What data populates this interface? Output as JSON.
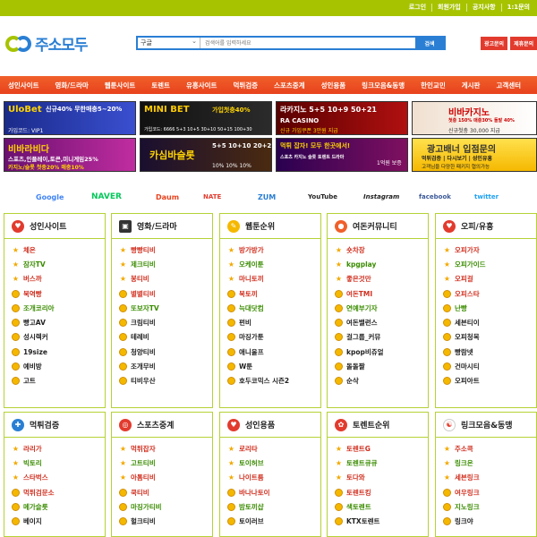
{
  "topbar": {
    "links": [
      "로그인",
      "회원가입",
      "공지사항",
      "1:1문의"
    ]
  },
  "logo": {
    "text": "주소모두"
  },
  "search": {
    "select": "구글",
    "placeholder": "검색어를 입력하세요",
    "button": "검색"
  },
  "ad_buttons": [
    "광고문의",
    "제휴문의"
  ],
  "nav": [
    "성인사이트",
    "영화/드라마",
    "웹툰사이트",
    "토렌트",
    "유흥사이트",
    "먹튀검증",
    "스포츠중계",
    "성인용품",
    "링크모음&동맹",
    "한인교민",
    "게시판",
    "고객센터"
  ],
  "banners": [
    {
      "t1": "UloBet",
      "t2": "신규40% 무한매충5~20%",
      "t3": "가입코드: VIP1"
    },
    {
      "t1": "MINI BET",
      "t2": "가입첫충40%",
      "t3": "가입코드: 6666 5+3 10+5 30+10 50+15 100+30"
    },
    {
      "t1": "라카지노 5+5 10+9 50+21",
      "t2": "RA CASINO",
      "t3": "신규 가입쿠폰 3만원 지급"
    },
    {
      "t1": "비바카지노",
      "t2": "첫충 150% 매충30% 돌발 40%",
      "t3": "신규첫충 30,000 지급"
    },
    {
      "t1": "비바라비다",
      "t2": "스포츠,인플레이,토큰,미니게임25%",
      "t3": "카지노/슬롯 첫충20% 매충10%"
    },
    {
      "t1": "카심바슬롯",
      "t2": "5+5 10+10 20+20",
      "t3": "10% 10% 10%"
    },
    {
      "t1": "먹튀 잡자! 모두 한곳에서!",
      "t2": "스포츠 카지노 슬롯 토렌트 드라마",
      "t3": "1억원 보증"
    },
    {
      "t1": "광고배너 입점문의",
      "t2": "먹튀검증 | 다시보기 | 성인유흥",
      "t3": "고객님을 다양한 패키지 협의가능"
    }
  ],
  "portals": [
    "Google",
    "NAVER",
    "Daum",
    "NATE",
    "ZUM",
    "YouTube",
    "Instagram",
    "facebook",
    "twitter"
  ],
  "cards": [
    {
      "title": "성인사이트",
      "items": [
        "체온",
        "잠자TV",
        "버스까",
        "북역빵",
        "조개코리아",
        "빵고AV",
        "성시렉커",
        "19size",
        "예비방",
        "고트"
      ]
    },
    {
      "title": "영화/드라마",
      "items": [
        "빵빵티비",
        "제크티비",
        "봉티비",
        "별별티비",
        "또보자TV",
        "크림티비",
        "테레비",
        "청양티비",
        "조개무비",
        "티비우산"
      ]
    },
    {
      "title": "웹툰순위",
      "items": [
        "방가방가",
        "오케이툰",
        "마니토끼",
        "북토끼",
        "늑대닷컴",
        "펀비",
        "마징가툰",
        "애니울프",
        "W툰",
        "호두코믹스 시즌2"
      ]
    },
    {
      "title": "여돈커뮤니티",
      "items": [
        "숏차장",
        "kpgplay",
        "좋은것만",
        "여돈TMI",
        "연예부기자",
        "여돈밸런스",
        "걸그룹_커뮤",
        "kpop비쥬얼",
        "돌돌짤",
        "순삭"
      ]
    },
    {
      "title": "오피/유흥",
      "items": [
        "오피가자",
        "오피가이드",
        "오피걸",
        "오피스타",
        "난빵",
        "세븐티이",
        "오피청목",
        "빵람넷",
        "건마시티",
        "오피아트"
      ]
    },
    {
      "title": "먹튀검증",
      "items": [
        "라리가",
        "빅토리",
        "스타벅스",
        "먹튀검문소",
        "메가슬롯",
        "베이지"
      ]
    },
    {
      "title": "스포츠중계",
      "items": [
        "먹튀잡자",
        "고트티비",
        "아톰티비",
        "쿡티비",
        "마징가티비",
        "헐크티비"
      ]
    },
    {
      "title": "성인용품",
      "items": [
        "로리타",
        "토이허브",
        "나이트룸",
        "바나나토이",
        "밤토끼샵",
        "토이러브"
      ]
    },
    {
      "title": "토렌트순위",
      "items": [
        "토렌트G",
        "토렌트큐큐",
        "토다와",
        "토렌트킹",
        "색토렌트",
        "KTX토렌트"
      ]
    },
    {
      "title": "링크모음&동맹",
      "items": [
        "주소콕",
        "링크온",
        "세븐링크",
        "여우링크",
        "지노링크",
        "링크야"
      ]
    }
  ],
  "colors": {
    "topbar": "#a7c300",
    "nav": "#e8421d",
    "accent_blue": "#2a7fd4",
    "card_border": "#b5d236"
  }
}
